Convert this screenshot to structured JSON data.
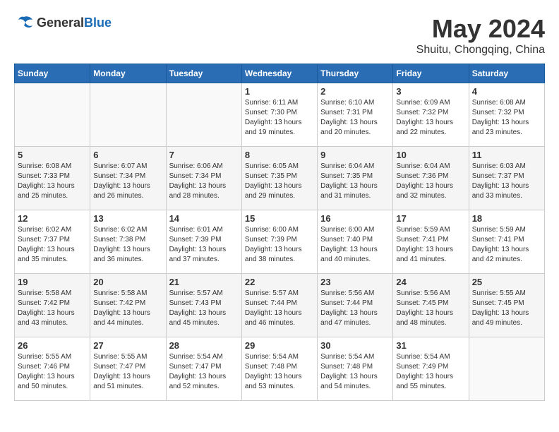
{
  "header": {
    "logo": {
      "general": "General",
      "blue": "Blue"
    },
    "title": "May 2024",
    "location": "Shuitu, Chongqing, China"
  },
  "calendar": {
    "days_of_week": [
      "Sunday",
      "Monday",
      "Tuesday",
      "Wednesday",
      "Thursday",
      "Friday",
      "Saturday"
    ],
    "weeks": [
      [
        {
          "day": "",
          "info": ""
        },
        {
          "day": "",
          "info": ""
        },
        {
          "day": "",
          "info": ""
        },
        {
          "day": "1",
          "info": "Sunrise: 6:11 AM\nSunset: 7:30 PM\nDaylight: 13 hours\nand 19 minutes."
        },
        {
          "day": "2",
          "info": "Sunrise: 6:10 AM\nSunset: 7:31 PM\nDaylight: 13 hours\nand 20 minutes."
        },
        {
          "day": "3",
          "info": "Sunrise: 6:09 AM\nSunset: 7:32 PM\nDaylight: 13 hours\nand 22 minutes."
        },
        {
          "day": "4",
          "info": "Sunrise: 6:08 AM\nSunset: 7:32 PM\nDaylight: 13 hours\nand 23 minutes."
        }
      ],
      [
        {
          "day": "5",
          "info": "Sunrise: 6:08 AM\nSunset: 7:33 PM\nDaylight: 13 hours\nand 25 minutes."
        },
        {
          "day": "6",
          "info": "Sunrise: 6:07 AM\nSunset: 7:34 PM\nDaylight: 13 hours\nand 26 minutes."
        },
        {
          "day": "7",
          "info": "Sunrise: 6:06 AM\nSunset: 7:34 PM\nDaylight: 13 hours\nand 28 minutes."
        },
        {
          "day": "8",
          "info": "Sunrise: 6:05 AM\nSunset: 7:35 PM\nDaylight: 13 hours\nand 29 minutes."
        },
        {
          "day": "9",
          "info": "Sunrise: 6:04 AM\nSunset: 7:35 PM\nDaylight: 13 hours\nand 31 minutes."
        },
        {
          "day": "10",
          "info": "Sunrise: 6:04 AM\nSunset: 7:36 PM\nDaylight: 13 hours\nand 32 minutes."
        },
        {
          "day": "11",
          "info": "Sunrise: 6:03 AM\nSunset: 7:37 PM\nDaylight: 13 hours\nand 33 minutes."
        }
      ],
      [
        {
          "day": "12",
          "info": "Sunrise: 6:02 AM\nSunset: 7:37 PM\nDaylight: 13 hours\nand 35 minutes."
        },
        {
          "day": "13",
          "info": "Sunrise: 6:02 AM\nSunset: 7:38 PM\nDaylight: 13 hours\nand 36 minutes."
        },
        {
          "day": "14",
          "info": "Sunrise: 6:01 AM\nSunset: 7:39 PM\nDaylight: 13 hours\nand 37 minutes."
        },
        {
          "day": "15",
          "info": "Sunrise: 6:00 AM\nSunset: 7:39 PM\nDaylight: 13 hours\nand 38 minutes."
        },
        {
          "day": "16",
          "info": "Sunrise: 6:00 AM\nSunset: 7:40 PM\nDaylight: 13 hours\nand 40 minutes."
        },
        {
          "day": "17",
          "info": "Sunrise: 5:59 AM\nSunset: 7:41 PM\nDaylight: 13 hours\nand 41 minutes."
        },
        {
          "day": "18",
          "info": "Sunrise: 5:59 AM\nSunset: 7:41 PM\nDaylight: 13 hours\nand 42 minutes."
        }
      ],
      [
        {
          "day": "19",
          "info": "Sunrise: 5:58 AM\nSunset: 7:42 PM\nDaylight: 13 hours\nand 43 minutes."
        },
        {
          "day": "20",
          "info": "Sunrise: 5:58 AM\nSunset: 7:42 PM\nDaylight: 13 hours\nand 44 minutes."
        },
        {
          "day": "21",
          "info": "Sunrise: 5:57 AM\nSunset: 7:43 PM\nDaylight: 13 hours\nand 45 minutes."
        },
        {
          "day": "22",
          "info": "Sunrise: 5:57 AM\nSunset: 7:44 PM\nDaylight: 13 hours\nand 46 minutes."
        },
        {
          "day": "23",
          "info": "Sunrise: 5:56 AM\nSunset: 7:44 PM\nDaylight: 13 hours\nand 47 minutes."
        },
        {
          "day": "24",
          "info": "Sunrise: 5:56 AM\nSunset: 7:45 PM\nDaylight: 13 hours\nand 48 minutes."
        },
        {
          "day": "25",
          "info": "Sunrise: 5:55 AM\nSunset: 7:45 PM\nDaylight: 13 hours\nand 49 minutes."
        }
      ],
      [
        {
          "day": "26",
          "info": "Sunrise: 5:55 AM\nSunset: 7:46 PM\nDaylight: 13 hours\nand 50 minutes."
        },
        {
          "day": "27",
          "info": "Sunrise: 5:55 AM\nSunset: 7:47 PM\nDaylight: 13 hours\nand 51 minutes."
        },
        {
          "day": "28",
          "info": "Sunrise: 5:54 AM\nSunset: 7:47 PM\nDaylight: 13 hours\nand 52 minutes."
        },
        {
          "day": "29",
          "info": "Sunrise: 5:54 AM\nSunset: 7:48 PM\nDaylight: 13 hours\nand 53 minutes."
        },
        {
          "day": "30",
          "info": "Sunrise: 5:54 AM\nSunset: 7:48 PM\nDaylight: 13 hours\nand 54 minutes."
        },
        {
          "day": "31",
          "info": "Sunrise: 5:54 AM\nSunset: 7:49 PM\nDaylight: 13 hours\nand 55 minutes."
        },
        {
          "day": "",
          "info": ""
        }
      ]
    ]
  }
}
